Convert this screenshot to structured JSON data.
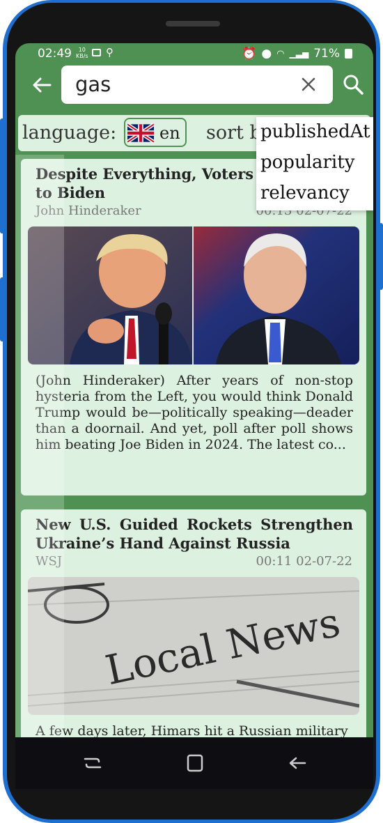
{
  "status_bar": {
    "time": "02:49",
    "kbs_top": "10",
    "kbs_bottom": "KB/s",
    "battery": "71%"
  },
  "search": {
    "query": "gas"
  },
  "filters": {
    "language_label": "language:",
    "language_code": "en",
    "sort_label": "sort b",
    "sort_options": [
      "publishedAt",
      "popularity",
      "relevancy"
    ]
  },
  "articles": [
    {
      "title": "Despite Everything, Voters P to Biden",
      "title_line1": "Despite Everything, Voters P",
      "title_line2": "to Biden",
      "source": "John Hinderaker",
      "date": "00:13 02-07-22",
      "description": "(John Hinderaker) After years of non-stop hysteria from the Left, you would think Donald Trump would be—politically speaking—deader than a doornail. And yet, poll after poll shows him beating Joe Biden in 2024. The latest co..."
    },
    {
      "title": "New U.S. Guided Rockets Strengthen Ukraine’s Hand Against Russia",
      "source": "WSJ",
      "date": "00:11 02-07-22",
      "image_text": "Local News",
      "description": "A few days later, Himars hit a Russian military"
    }
  ],
  "colors": {
    "accent": "#4e9153",
    "card_bg": "#ddf1e0",
    "frame": "#1f6fd0"
  }
}
